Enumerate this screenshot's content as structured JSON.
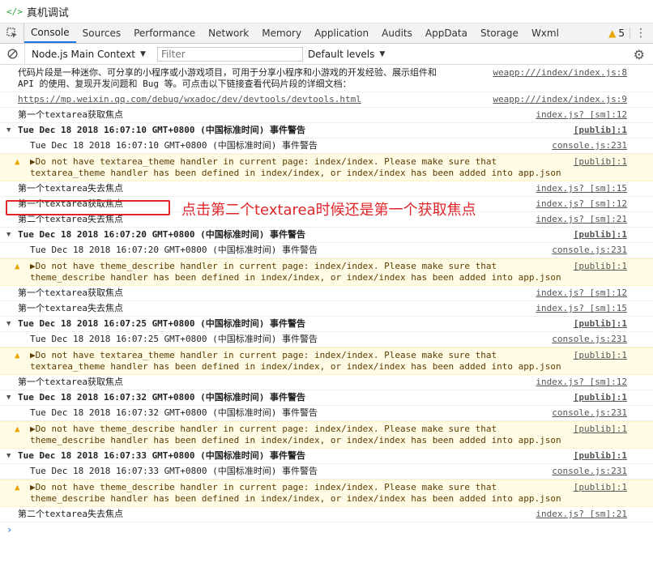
{
  "window": {
    "title": "真机调试",
    "icon": "code-icon"
  },
  "tabs": [
    {
      "label": "Console",
      "active": true
    },
    {
      "label": "Sources"
    },
    {
      "label": "Performance"
    },
    {
      "label": "Network"
    },
    {
      "label": "Memory"
    },
    {
      "label": "Application"
    },
    {
      "label": "Audits"
    },
    {
      "label": "AppData"
    },
    {
      "label": "Storage"
    },
    {
      "label": "Wxml"
    }
  ],
  "toolbar": {
    "warning_count": "5",
    "warning_icon": "warning-icon",
    "more_icon": "kebab-icon"
  },
  "filterbar": {
    "context": "Node.js Main Context",
    "filter_placeholder": "Filter",
    "levels": "Default levels"
  },
  "console": {
    "rows": [
      {
        "type": "log",
        "text": "代码片段是一种迷你、可分享的小程序或小游戏项目，可用于分享小程序和小游戏的开发经验、展示组件和\nAPI 的使用、复现开发问题和 Bug 等。可点击以下链接查看代码片段的详细文档：",
        "source": "weapp:///index/index.js:8"
      },
      {
        "type": "log",
        "text": "https://mp.weixin.qq.com/debug/wxadoc/dev/devtools/devtools.html",
        "source": "weapp:///index/index.js:9",
        "is_link": true
      },
      {
        "type": "log",
        "text": "第一个textarea获取焦点",
        "source": "index.js? [sm]:12"
      },
      {
        "type": "group",
        "text": "Tue Dec 18 2018 16:07:10 GMT+0800 (中国标准时间) 事件警告",
        "source": "[publib]:1"
      },
      {
        "type": "indent",
        "text": "Tue Dec 18 2018 16:07:10 GMT+0800 (中国标准时间) 事件警告",
        "source": "console.js:231"
      },
      {
        "type": "warn",
        "text": "▶Do not have textarea_theme handler in current page: index/index. Please make sure that\ntextarea_theme handler has been defined in index/index, or index/index has been added into app.json",
        "source": "[publib]:1"
      },
      {
        "type": "log",
        "text": "第一个textarea失去焦点",
        "source": "index.js? [sm]:15"
      },
      {
        "type": "log",
        "text": "第一个textarea获取焦点",
        "source": "index.js? [sm]:12",
        "highlighted": true
      },
      {
        "type": "log",
        "text": "第二个textarea失去焦点",
        "source": "index.js? [sm]:21"
      },
      {
        "type": "group",
        "text": "Tue Dec 18 2018 16:07:20 GMT+0800 (中国标准时间) 事件警告",
        "source": "[publib]:1"
      },
      {
        "type": "indent",
        "text": "Tue Dec 18 2018 16:07:20 GMT+0800 (中国标准时间) 事件警告",
        "source": "console.js:231"
      },
      {
        "type": "warn",
        "text": "▶Do not have theme_describe handler in current page: index/index. Please make sure that\ntheme_describe handler has been defined in index/index, or index/index has been added into app.json",
        "source": "[publib]:1"
      },
      {
        "type": "log",
        "text": "第一个textarea获取焦点",
        "source": "index.js? [sm]:12"
      },
      {
        "type": "log",
        "text": "第一个textarea失去焦点",
        "source": "index.js? [sm]:15"
      },
      {
        "type": "group",
        "text": "Tue Dec 18 2018 16:07:25 GMT+0800 (中国标准时间) 事件警告",
        "source": "[publib]:1"
      },
      {
        "type": "indent",
        "text": "Tue Dec 18 2018 16:07:25 GMT+0800 (中国标准时间) 事件警告",
        "source": "console.js:231"
      },
      {
        "type": "warn",
        "text": "▶Do not have textarea_theme handler in current page: index/index. Please make sure that\ntextarea_theme handler has been defined in index/index, or index/index has been added into app.json",
        "source": "[publib]:1"
      },
      {
        "type": "log",
        "text": "第一个textarea获取焦点",
        "source": "index.js? [sm]:12"
      },
      {
        "type": "group",
        "text": "Tue Dec 18 2018 16:07:32 GMT+0800 (中国标准时间) 事件警告",
        "source": "[publib]:1"
      },
      {
        "type": "indent",
        "text": "Tue Dec 18 2018 16:07:32 GMT+0800 (中国标准时间) 事件警告",
        "source": "console.js:231"
      },
      {
        "type": "warn",
        "text": "▶Do not have theme_describe handler in current page: index/index. Please make sure that\ntheme_describe handler has been defined in index/index, or index/index has been added into app.json",
        "source": "[publib]:1"
      },
      {
        "type": "group",
        "text": "Tue Dec 18 2018 16:07:33 GMT+0800 (中国标准时间) 事件警告",
        "source": "[publib]:1"
      },
      {
        "type": "indent",
        "text": "Tue Dec 18 2018 16:07:33 GMT+0800 (中国标准时间) 事件警告",
        "source": "console.js:231"
      },
      {
        "type": "warn",
        "text": "▶Do not have theme_describe handler in current page: index/index. Please make sure that\ntheme_describe handler has been defined in index/index, or index/index has been added into app.json",
        "source": "[publib]:1"
      },
      {
        "type": "log",
        "text": "第二个textarea失去焦点",
        "source": "index.js? [sm]:21"
      }
    ],
    "prompt": "›"
  },
  "annotation": {
    "text": "点击第二个textarea时候还是第一个获取焦点",
    "color": "#e0262b"
  }
}
